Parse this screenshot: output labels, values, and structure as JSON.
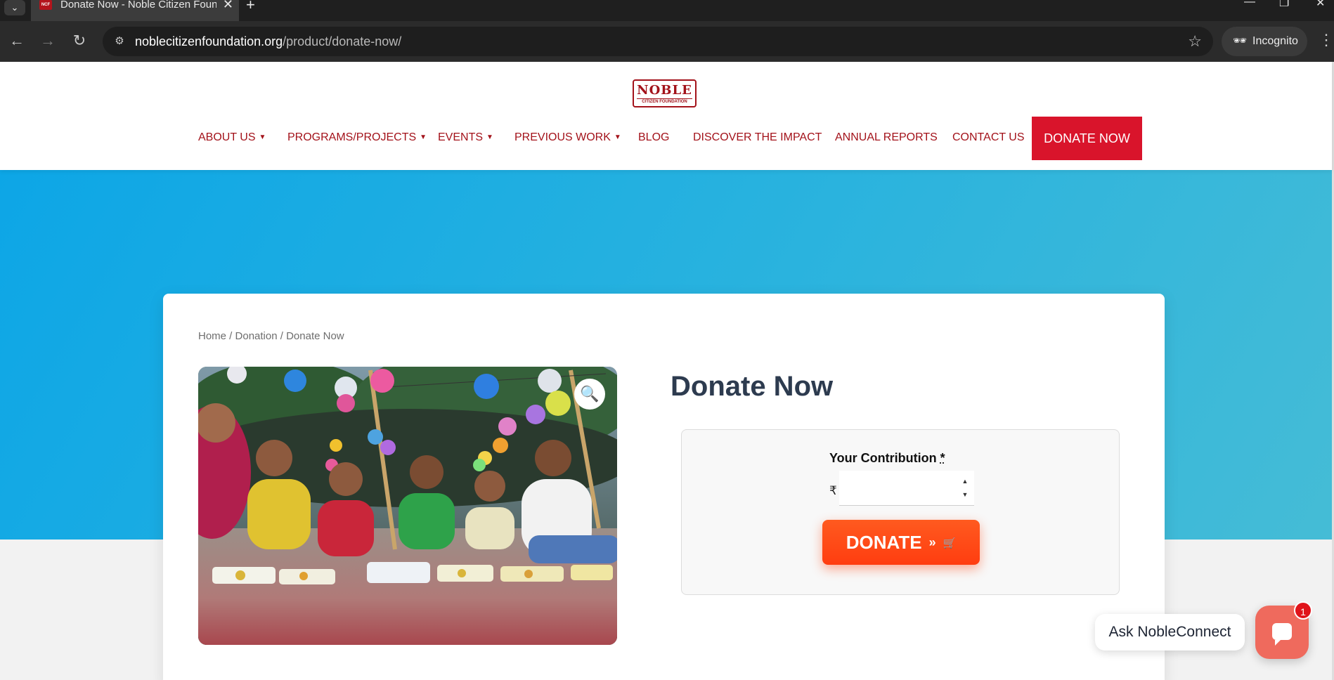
{
  "browser": {
    "tab_title": "Donate Now - Noble Citizen Foundation",
    "tab_favicon_text": "NCF",
    "url_host": "noblecitizenfoundation.org",
    "url_path": "/product/donate-now/",
    "incognito_label": "Incognito"
  },
  "site": {
    "logo_main": "NOBLE",
    "logo_sub": "CITIZEN FOUNDATION",
    "nav": [
      {
        "label": "ABOUT US",
        "dropdown": true
      },
      {
        "label": "PROGRAMS/PROJECTS",
        "dropdown": true
      },
      {
        "label": "EVENTS",
        "dropdown": true
      },
      {
        "label": "PREVIOUS WORK",
        "dropdown": true
      },
      {
        "label": "BLOG",
        "dropdown": false
      },
      {
        "label": "DISCOVER THE IMPACT",
        "dropdown": false
      },
      {
        "label": "ANNUAL REPORTS",
        "dropdown": false
      },
      {
        "label": "CONTACT US",
        "dropdown": false
      }
    ],
    "donate_nav_label": "DONATE NOW",
    "colors": {
      "brand_red": "#a3121a",
      "cta_red": "#d9142b",
      "hero_blue": "#1aa9e2",
      "donate_orange": "#ff4a15",
      "title_navy": "#2d3b4f"
    }
  },
  "breadcrumb": {
    "home": "Home",
    "sep": " / ",
    "category": "Donation",
    "current": "Donate Now"
  },
  "product": {
    "title": "Donate Now",
    "image_icon": "magnifier-icon",
    "contribution_label": "Your Contribution",
    "required_mark": "*",
    "currency_symbol": "₹",
    "amount_value": "",
    "donate_button_label": "DONATE",
    "donate_button_suffix": "»"
  },
  "chat": {
    "prompt": "Ask NobleConnect",
    "badge_count": "1"
  }
}
